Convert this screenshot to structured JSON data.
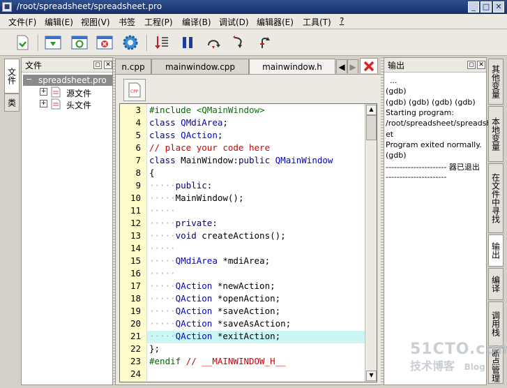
{
  "window": {
    "title": "/root/spreadsheet/spreadsheet.pro"
  },
  "menu": [
    "文件(F)",
    "编辑(E)",
    "视图(V)",
    "书签",
    "工程(P)",
    "编译(B)",
    "调试(D)",
    "编辑器(E)",
    "工具(T)",
    "?"
  ],
  "left_tabs": [
    "文件",
    "类"
  ],
  "file_panel": {
    "title": "文件",
    "root": "spreadsheet.pro",
    "children": [
      "源文件",
      "头文件"
    ]
  },
  "editor": {
    "tabs": [
      "n.cpp",
      "mainwindow.cpp",
      "mainwindow.h"
    ],
    "line_numbers": [
      "3",
      "4",
      "5",
      "6",
      "7",
      "8",
      "9",
      "10",
      "11",
      "12",
      "13",
      "14",
      "15",
      "16",
      "17",
      "18",
      "19",
      "20",
      "21",
      "22",
      "23",
      "24"
    ],
    "lines": [
      "#include <QMainWindow>",
      "class QMdiArea;",
      "class QAction;",
      "// place your code here",
      "class MainWindow:public QMainWindow",
      "{",
      "·····public:",
      "·····MainWindow();",
      "·····",
      "·····private:",
      "·····void createActions();",
      "·····",
      "·····QMdiArea *mdiArea;",
      "·····",
      "·····QAction *newAction;",
      "·····QAction *openAction;",
      "·····QAction *saveAction;",
      "·····QAction *saveAsAction;",
      "·····QAction *exitAction;",
      "};",
      "#endif // __MAINWINDOW_H__",
      ""
    ],
    "highlighted_line": "21"
  },
  "output_panel": {
    "title": "输出",
    "lines": [
      "...",
      "(gdb)",
      "(gdb) (gdb) (gdb) (gdb)",
      "Starting program:",
      "/root/spreadsheet/spreadshe",
      "et",
      "Program exited normally.",
      "(gdb)",
      "----------------------  器已退出",
      "----------------------"
    ]
  },
  "right_tabs": [
    "其他变量",
    "本地变量",
    "在文件中寻找",
    "输出",
    "编译",
    "调用栈",
    "断点管理"
  ],
  "watermark": {
    "line1": "51CTO.com",
    "line2": "技术博客",
    "line3": "Blog"
  },
  "colors": {
    "keyword": "#000080",
    "type": "#0000cc",
    "comment": "#cc0000",
    "preproc": "#006600",
    "string": "#007700",
    "highlight": "#ccf6f6"
  }
}
